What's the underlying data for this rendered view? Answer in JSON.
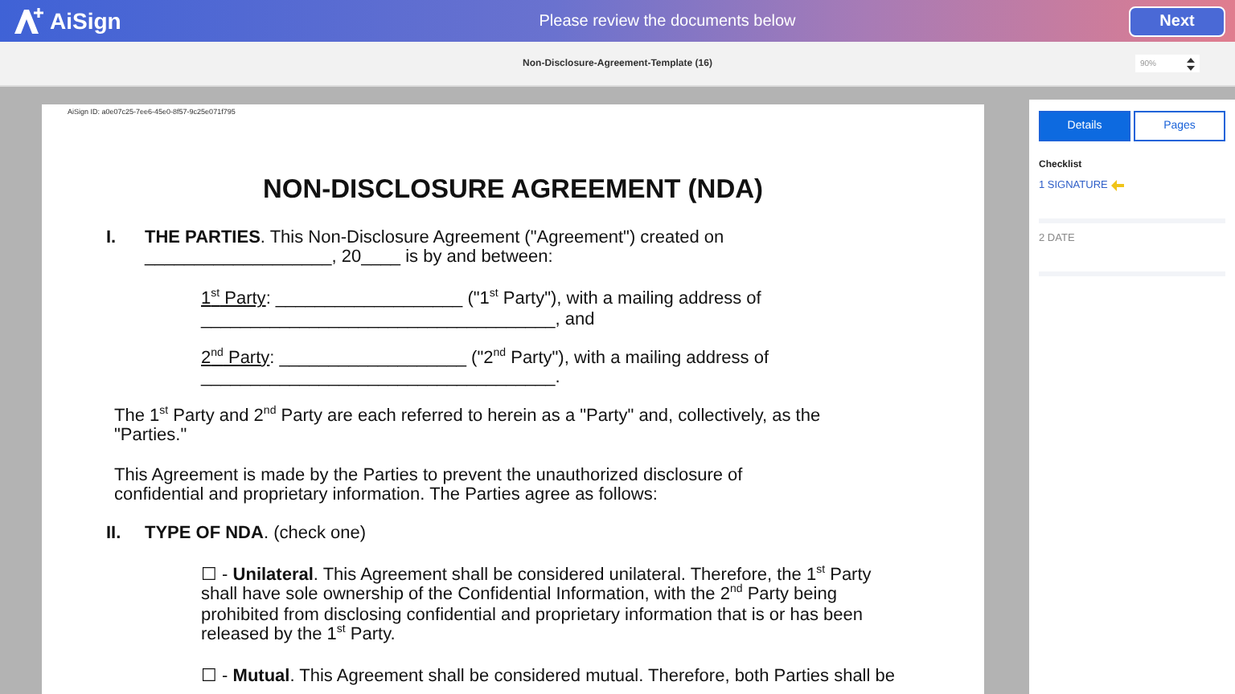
{
  "header": {
    "brand": "AiSign",
    "message": "Please review the documents below",
    "next_button": "Next"
  },
  "toolbar": {
    "document_name": "Non-Disclosure-Agreement-Template (16)",
    "zoom": "90%"
  },
  "document": {
    "id_line": "AiSign ID: a0e07c25-7ee6-45e0-8f57-9c25e071f795",
    "title": "NON-DISCLOSURE AGREEMENT (NDA)",
    "blocks": [
      {
        "kind": "section",
        "number": "I.",
        "text": "**THE PARTIES**. This Non-Disclosure Agreement (\"Agreement\") created on ___________________, 20____ is by and between:"
      },
      {
        "kind": "party",
        "label": "1$^{st}$ Party",
        "text": ": ___________________ (\"1$^{st}$ Party\"), with a mailing address of ____________________________________, and"
      },
      {
        "kind": "party",
        "label": "2$^{nd}$ Party",
        "text": ": ___________________ (\"2$^{nd}$ Party\"), with a mailing address of ____________________________________."
      },
      {
        "kind": "paragraph",
        "text": "The 1$^{st}$ Party and 2$^{nd}$ Party are each referred to herein as a \"Party\" and, collectively, as the \"Parties.\""
      },
      {
        "kind": "paragraph",
        "text": "This Agreement is made by the Parties to prevent the unauthorized disclosure of confidential and proprietary information. The Parties agree as follows:"
      },
      {
        "kind": "section",
        "number": "II.",
        "text": "**TYPE OF NDA**. (check one)"
      },
      {
        "kind": "option",
        "box": "☐",
        "text": "- **Unilateral**. This Agreement shall be considered unilateral. Therefore, the 1$^{st}$ Party shall have sole ownership of the Confidential Information, with the 2$^{nd}$ Party being prohibited from disclosing confidential and proprietary information that is or has been released by the 1$^{st}$ Party."
      },
      {
        "kind": "option",
        "box": "☐",
        "text": "- **Mutual**. This Agreement shall be considered mutual. Therefore, both Parties shall be"
      }
    ]
  },
  "sidebar": {
    "tabs": [
      {
        "label": "Details",
        "selected": true
      },
      {
        "label": "Pages",
        "selected": false
      }
    ],
    "checklist_title": "Checklist",
    "checklist": [
      {
        "label": "1 SIGNATURE",
        "selected": true
      },
      {
        "label": "2 DATE",
        "selected": false
      }
    ]
  }
}
